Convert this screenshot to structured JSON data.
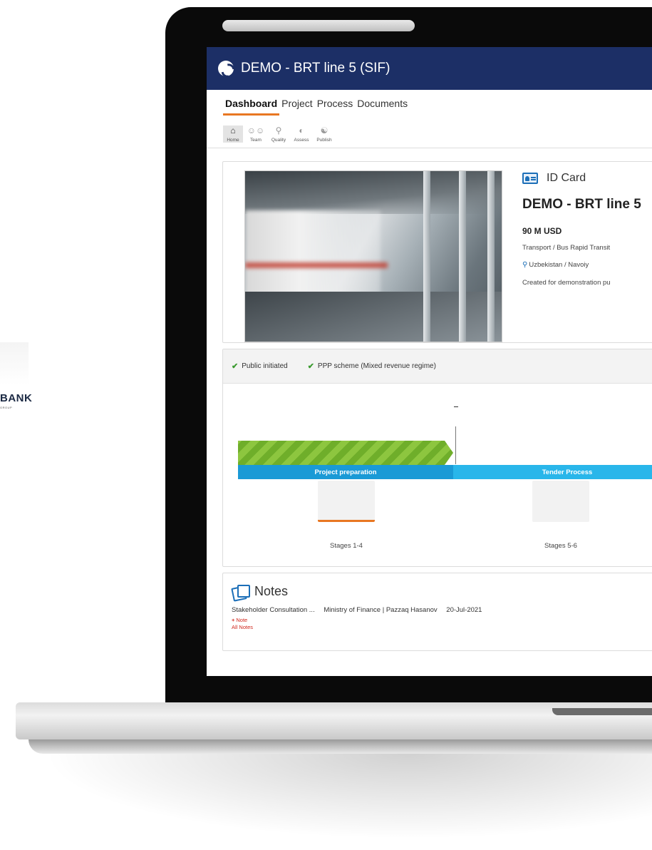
{
  "background_logo": {
    "text": "BANK",
    "sub": "GROUP"
  },
  "app": {
    "title": "DEMO - BRT line 5 (SIF)"
  },
  "nav": {
    "tabs": [
      {
        "label": "Dashboard",
        "active": true
      },
      {
        "label": "Project",
        "active": false
      },
      {
        "label": "Process",
        "active": false
      },
      {
        "label": "Documents",
        "active": false
      }
    ],
    "tools": [
      {
        "label": "Home",
        "icon": "home-icon",
        "active": true
      },
      {
        "label": "Team",
        "icon": "team-icon",
        "active": false
      },
      {
        "label": "Quality",
        "icon": "search-icon",
        "active": false
      },
      {
        "label": "Assess",
        "icon": "gauge-icon",
        "active": false
      },
      {
        "label": "Publish",
        "icon": "handshake-icon",
        "active": false
      }
    ]
  },
  "id_card": {
    "heading": "ID Card",
    "project_name": "DEMO - BRT line 5",
    "budget": "90 M USD",
    "sector": "Transport / Bus Rapid Transit",
    "location": "Uzbekistan / Navoiy",
    "description": "Created for demonstration pu"
  },
  "status": {
    "checks": [
      "Public initiated",
      "PPP scheme (Mixed revenue regime)"
    ],
    "today_marker": "–",
    "phases": [
      "Project preparation",
      "Tender Process"
    ],
    "stages": [
      "Stages 1-4",
      "Stages 5-6"
    ],
    "progress_fraction_of_phase1": 1.0
  },
  "notes": {
    "title": "Notes",
    "items": [
      {
        "subject": "Stakeholder Consultation ...",
        "author": "Ministry of Finance | Pazzaq Hasanov",
        "date": "20-Jul-2021"
      }
    ],
    "add_label": "Note",
    "all_label": "All Notes"
  },
  "colors": {
    "header": "#1c2f66",
    "accent": "#e87722",
    "phase1": "#1a9ad6",
    "phase2": "#29b6ea",
    "progress": "#8dc63f"
  }
}
